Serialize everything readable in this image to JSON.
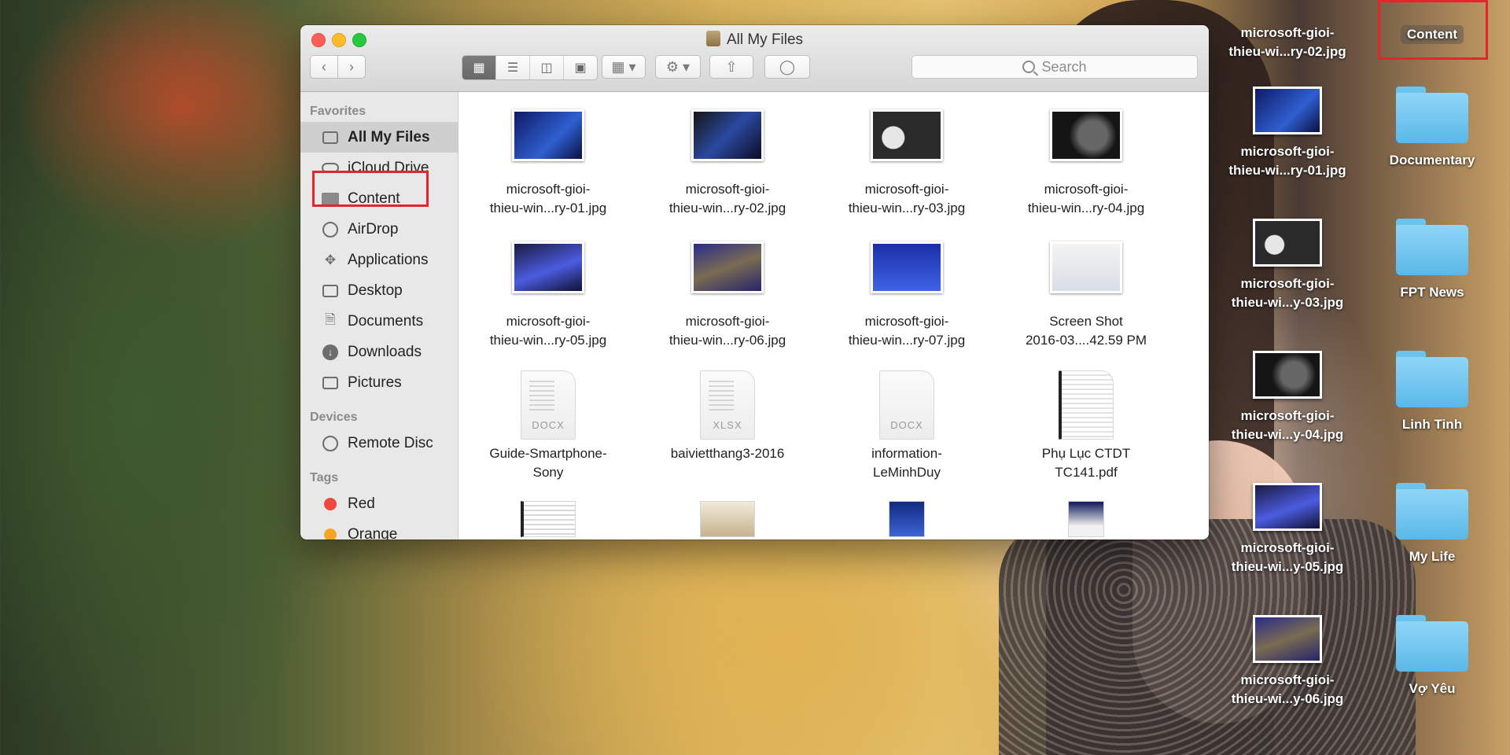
{
  "window": {
    "title": "All My Files",
    "search_placeholder": "Search"
  },
  "sidebar": {
    "favorites_header": "Favorites",
    "favorites": [
      {
        "label": "All My Files",
        "icon": "all-files-icon"
      },
      {
        "label": "iCloud Drive",
        "icon": "cloud-icon"
      },
      {
        "label": "Content",
        "icon": "folder-icon"
      },
      {
        "label": "AirDrop",
        "icon": "airdrop-icon"
      },
      {
        "label": "Applications",
        "icon": "applications-icon"
      },
      {
        "label": "Desktop",
        "icon": "desktop-icon"
      },
      {
        "label": "Documents",
        "icon": "documents-icon"
      },
      {
        "label": "Downloads",
        "icon": "downloads-icon"
      },
      {
        "label": "Pictures",
        "icon": "camera-icon"
      }
    ],
    "devices_header": "Devices",
    "devices": [
      {
        "label": "Remote Disc",
        "icon": "disc-icon"
      }
    ],
    "tags_header": "Tags",
    "tags": [
      {
        "label": "Red",
        "color": "#f0473f"
      },
      {
        "label": "Orange",
        "color": "#f5a623"
      }
    ]
  },
  "files": [
    {
      "line1": "microsoft-gioi-",
      "line2": "thieu-win...ry-01.jpg"
    },
    {
      "line1": "microsoft-gioi-",
      "line2": "thieu-win...ry-02.jpg"
    },
    {
      "line1": "microsoft-gioi-",
      "line2": "thieu-win...ry-03.jpg"
    },
    {
      "line1": "microsoft-gioi-",
      "line2": "thieu-win...ry-04.jpg"
    },
    {
      "line1": "microsoft-gioi-",
      "line2": "thieu-win...ry-05.jpg"
    },
    {
      "line1": "microsoft-gioi-",
      "line2": "thieu-win...ry-06.jpg"
    },
    {
      "line1": "microsoft-gioi-",
      "line2": "thieu-win...ry-07.jpg"
    },
    {
      "line1": "Screen Shot",
      "line2": "2016-03....42.59 PM"
    },
    {
      "line1": "Guide-Smartphone-",
      "line2": "Sony",
      "ext": "DOCX"
    },
    {
      "line1": "baivietthang3-2016",
      "line2": "",
      "ext": "XLSX"
    },
    {
      "line1": "information-",
      "line2": "LeMinhDuy",
      "ext": "DOCX"
    },
    {
      "line1": "Phụ Lục CTDT",
      "line2": "TC141.pdf"
    }
  ],
  "desktop": {
    "content_label": "Content",
    "folders": [
      "Documentary",
      "FPT News",
      "Linh Tinh",
      "My Life",
      "Vợ Yêu"
    ],
    "images": [
      {
        "line1": "microsoft-gioi-",
        "line2": "thieu-wi...ry-02.jpg"
      },
      {
        "line1": "microsoft-gioi-",
        "line2": "thieu-wi...ry-01.jpg"
      },
      {
        "line1": "microsoft-gioi-",
        "line2": "thieu-wi...y-03.jpg"
      },
      {
        "line1": "microsoft-gioi-",
        "line2": "thieu-wi...y-04.jpg"
      },
      {
        "line1": "microsoft-gioi-",
        "line2": "thieu-wi...y-05.jpg"
      },
      {
        "line1": "microsoft-gioi-",
        "line2": "thieu-wi...y-06.jpg"
      }
    ]
  },
  "colors": {
    "highlight": "#e3262b",
    "folder_blue": "#5ab8e8"
  }
}
